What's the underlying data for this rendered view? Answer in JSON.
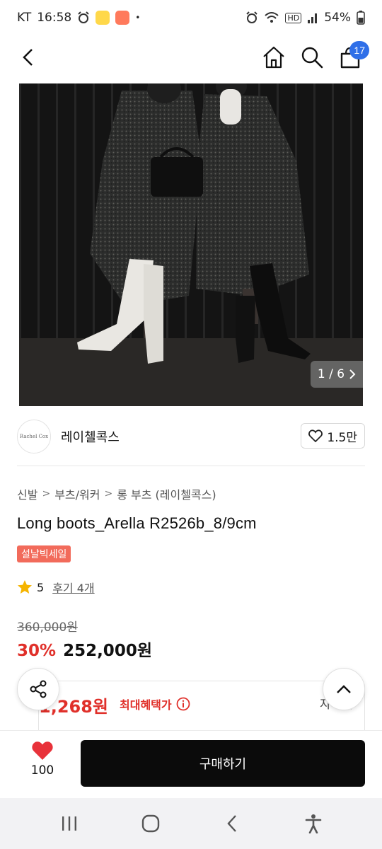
{
  "status_bar": {
    "carrier": "KT",
    "time": "16:58",
    "dot": "•",
    "network_badge": "HD",
    "battery": "54%"
  },
  "nav": {
    "cart_count": "17"
  },
  "hero": {
    "counter": "1 / 6"
  },
  "brand": {
    "logo_text": "Rachel Cox",
    "name": "레이첼콕스",
    "likes": "1.5만"
  },
  "breadcrumb": [
    "신발",
    "부츠/워커",
    "롱 부츠 (레이첼콕스)"
  ],
  "product": {
    "title": "Long boots_Arella R2526b_8/9cm",
    "sale_badge": "설날빅세일",
    "rating": "5",
    "review_link": "후기 4개",
    "original_price": "360,000원",
    "discount": "30%",
    "price": "252,000원"
  },
  "benefit": {
    "price": "1,268원",
    "label": "최대혜택가",
    "detail": "자세히"
  },
  "bottom": {
    "wish_count": "100",
    "buy_label": "구매하기"
  },
  "colors": {
    "accent_red": "#e0302a",
    "sale_badge": "#f26b5b",
    "cart_badge": "#2f6fe8",
    "buy_button": "#0b0b0b"
  },
  "icons": [
    "back-icon",
    "home-icon",
    "search-icon",
    "cart-icon",
    "chevron-right-icon",
    "heart-outline-icon",
    "star-icon",
    "info-icon",
    "share-icon",
    "chevron-up-icon",
    "heart-filled-icon",
    "recents-icon",
    "home-circle-icon",
    "nav-back-icon",
    "accessibility-icon"
  ]
}
